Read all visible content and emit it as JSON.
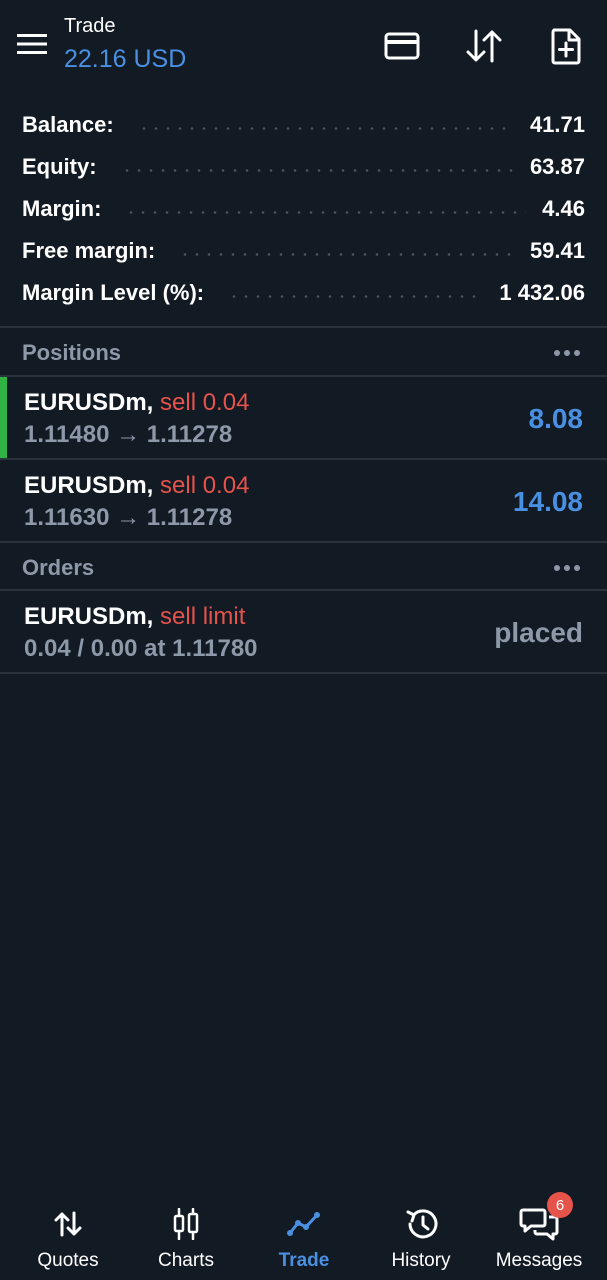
{
  "header": {
    "title": "Trade",
    "subtitle": "22.16 USD",
    "icons": [
      "menu-icon",
      "card-icon",
      "sort-arrows-icon",
      "new-order-icon"
    ]
  },
  "summary": [
    {
      "label": "Balance:",
      "value": "41.71"
    },
    {
      "label": "Equity:",
      "value": "63.87"
    },
    {
      "label": "Margin:",
      "value": "4.46"
    },
    {
      "label": "Free margin:",
      "value": "59.41"
    },
    {
      "label": "Margin Level (%):",
      "value": "1 432.06"
    }
  ],
  "positions": {
    "title": "Positions",
    "items": [
      {
        "symbol": "EURUSDm,",
        "side": " sell 0.04",
        "prices": "1.11480 → 1.11278",
        "profit": "8.08"
      },
      {
        "symbol": "EURUSDm,",
        "side": " sell 0.04",
        "prices": "1.11630 → 1.11278",
        "profit": "14.08"
      }
    ]
  },
  "orders": {
    "title": "Orders",
    "items": [
      {
        "symbol": "EURUSDm,",
        "side": " sell limit",
        "details": "0.04 / 0.00 at 1.11780",
        "status": "placed"
      }
    ]
  },
  "nav": {
    "items": [
      {
        "label": "Quotes",
        "icon": "quotes-icon"
      },
      {
        "label": "Charts",
        "icon": "charts-icon"
      },
      {
        "label": "Trade",
        "icon": "trade-icon"
      },
      {
        "label": "History",
        "icon": "history-icon"
      },
      {
        "label": "Messages",
        "icon": "messages-icon"
      }
    ],
    "active": "Trade",
    "messages_badge": "6"
  },
  "colors": {
    "background": "#121a24",
    "accent": "#4a90e2",
    "sell": "#e5534b",
    "muted": "#8d99a8",
    "position_marker": "#2fb344"
  }
}
